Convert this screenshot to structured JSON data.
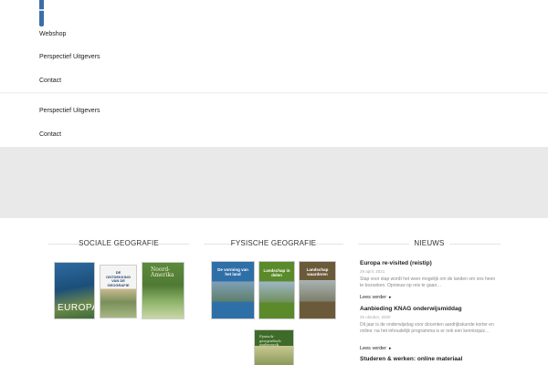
{
  "menu": {
    "items": [
      "Webshop",
      "Perspectief Uitgevers",
      "Contact"
    ],
    "items_secondary": [
      "Perspectief Uitgevers",
      "Contact"
    ]
  },
  "sections": {
    "sociale": {
      "title": "SOCIALE GEOGRAFIE",
      "books": [
        {
          "title": "EUROPA",
          "color": "#1c4f7a"
        },
        {
          "title": "DE ONTDEKKING VAN DE GEOGRAFIE",
          "color": "#f2f2f0"
        },
        {
          "title": "Noord-Amerika",
          "color": "#4f7a34"
        }
      ]
    },
    "fysische": {
      "title": "FYSISCHE GEOGRAFIE",
      "books": [
        {
          "title": "De vorming van het land",
          "color": "#2f6fa8"
        },
        {
          "title": "Landschap in delen",
          "color": "#5a8a2a"
        },
        {
          "title": "Landschap waarderen",
          "color": "#6b5a3a"
        },
        {
          "title": "Fysisch-geografisch onderzoek",
          "color": "#3f6b2a"
        }
      ]
    }
  },
  "news": {
    "title": "NIEUWS",
    "more_label": "Lees verder",
    "items": [
      {
        "title": "Europa re-visited (reistip)",
        "date": "29 april, 2021",
        "text": "Stap voor stap wordt het weer mogelijk om de landen om ons heen te bezoeken. Opnieuw op reis te gaan…"
      },
      {
        "title": "Aanbieding KNAG onderwijsmiddag",
        "date": "25 oktober, 2020",
        "text": "Dit jaar is de onderwijsdag voor docenten aardrijkskunde korter en online: na het inhoudelijk programma is er ook een kennisquiz…"
      },
      {
        "title": "Studeren & werken: online materiaal"
      }
    ]
  },
  "colors": {
    "accent": "#3a6ea5",
    "band": "#e9e9e9"
  }
}
